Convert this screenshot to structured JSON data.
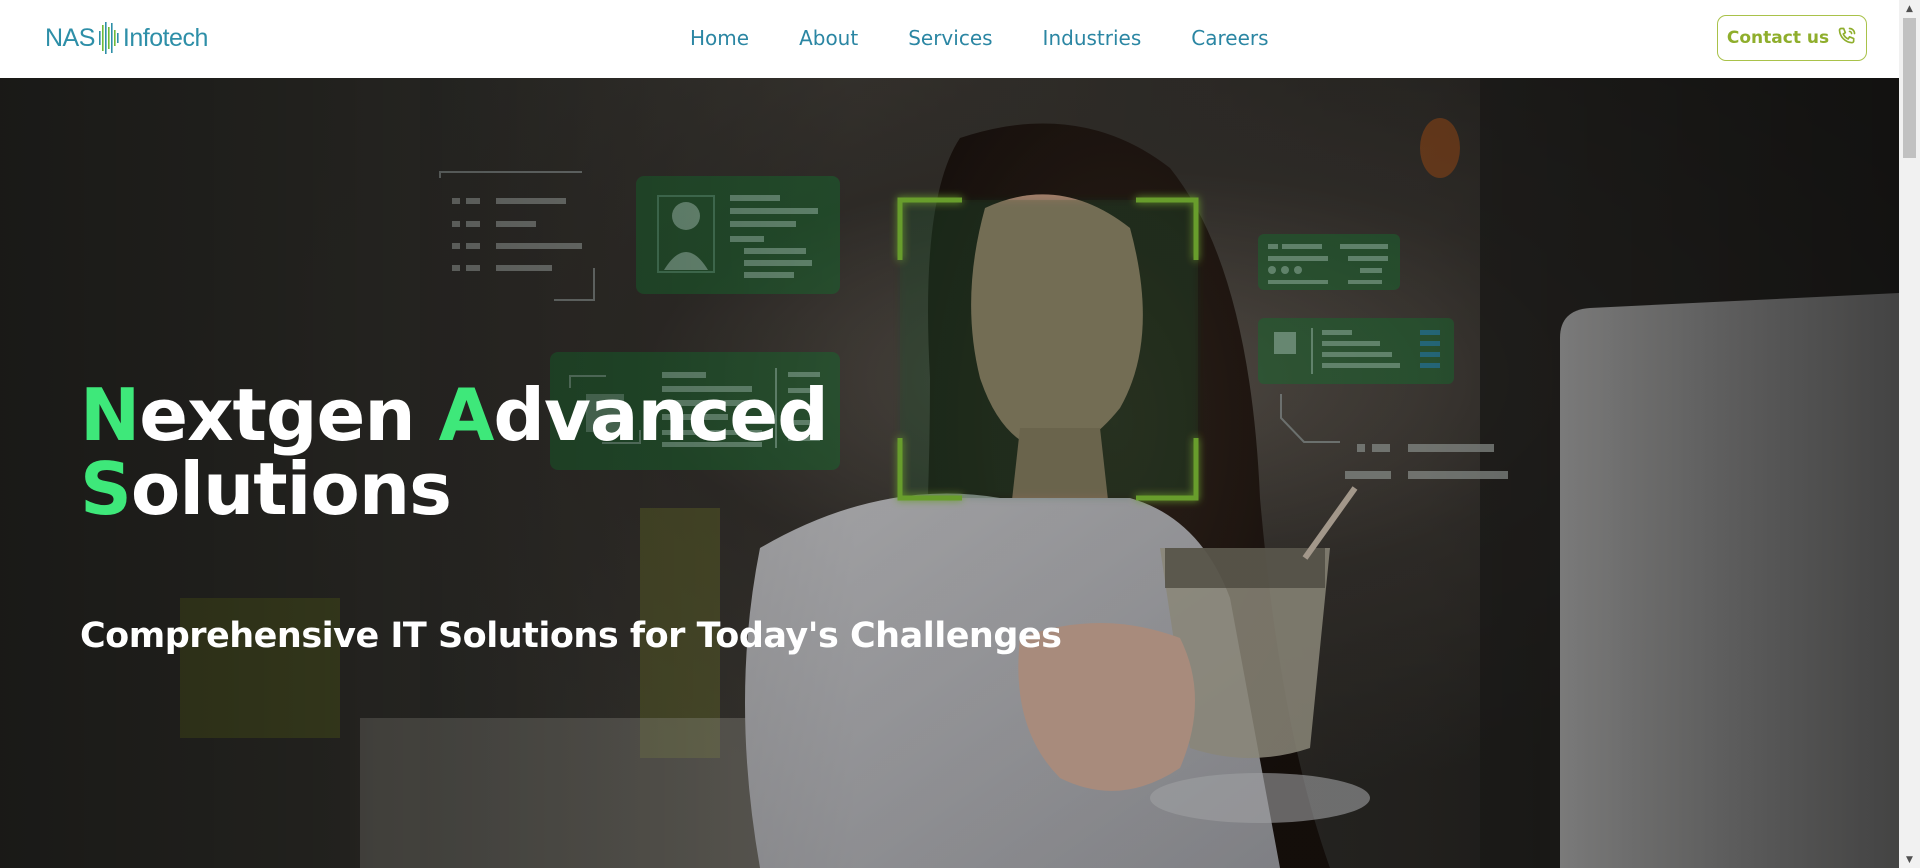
{
  "header": {
    "logo": {
      "left_text": "NAS",
      "right_text": "Infotech",
      "icon": "equalizer-bars-icon"
    },
    "nav": [
      {
        "label": "Home"
      },
      {
        "label": "About"
      },
      {
        "label": "Services"
      },
      {
        "label": "Industries"
      },
      {
        "label": "Careers"
      }
    ],
    "contact": {
      "label": "Contact us",
      "icon": "phone-icon"
    }
  },
  "hero": {
    "title": {
      "word1_initial": "N",
      "word1_rest": "extgen",
      "word2_initial": "A",
      "word2_rest": "dvanced",
      "word3_initial": "S",
      "word3_rest": "olutions"
    },
    "subtitle": "Comprehensive IT Solutions for Today's Challenges",
    "background": "woman-with-coffee-and-holographic-ui-photo"
  },
  "colors": {
    "brand_teal": "#2b86a3",
    "accent_green": "#3ee87a",
    "contact_olive": "#8fae2c",
    "hud_green": "#1f8a3c"
  },
  "scrollbar": {
    "up_icon": "scroll-up-arrow-icon",
    "down_icon": "scroll-down-arrow-icon"
  }
}
